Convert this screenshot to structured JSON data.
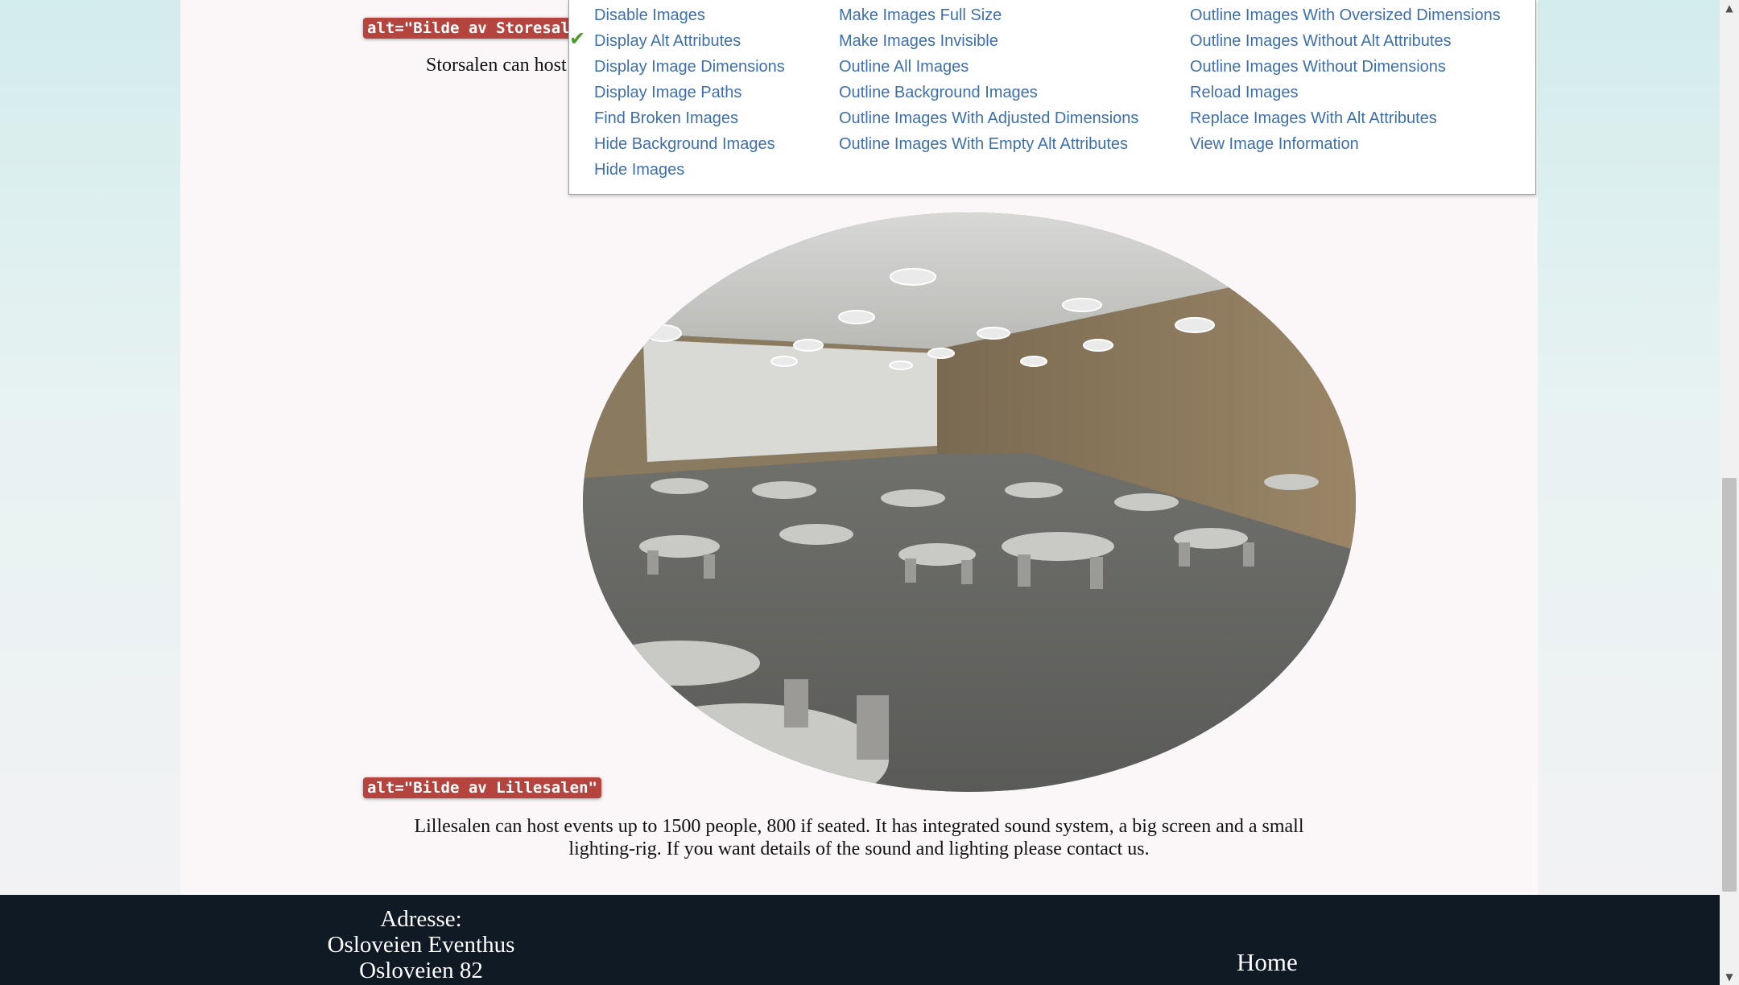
{
  "page": {
    "alt_storsalen": "alt=\"Bilde av Storesalen\"",
    "desc_storsalen": "Storsalen can host",
    "alt_lillesalen": "alt=\"Bilde av Lillesalen\"",
    "desc_lillesalen_line1": "Lillesalen can host events up to 1500 people, 800 if seated. It has integrated sound system, a big screen and a small",
    "desc_lillesalen_line2": "lighting-rig. If you want details of the sound and lighting please contact us."
  },
  "menu": {
    "col1": [
      "Disable Images",
      "Display Alt Attributes",
      "Display Image Dimensions",
      "Display Image Paths",
      "Find Broken Images",
      "Hide Background Images",
      "Hide Images"
    ],
    "col2": [
      "Make Images Full Size",
      "Make Images Invisible",
      "Outline All Images",
      "Outline Background Images",
      "Outline Images With Adjusted Dimensions",
      "Outline Images With Empty Alt Attributes"
    ],
    "col3": [
      "Outline Images With Oversized Dimensions",
      "Outline Images Without Alt Attributes",
      "Outline Images Without Dimensions",
      "Reload Images",
      "Replace Images With Alt Attributes",
      "View Image Information"
    ],
    "checked_item": "Display Alt Attributes"
  },
  "footer": {
    "address_label": "Adresse:",
    "address_line1": "Osloveien Eventhus",
    "address_line2": "Osloveien 82",
    "home_link": "Home"
  },
  "icons": {
    "check": "check-icon",
    "scroll_up": "scroll-up-arrow-icon",
    "scroll_down": "scroll-down-arrow-icon"
  },
  "colors": {
    "alt_badge": "#b5443f",
    "menu_link": "#3d6fae",
    "footer_bg": "#0f1a24",
    "page_bg": "#fbf7f8"
  }
}
